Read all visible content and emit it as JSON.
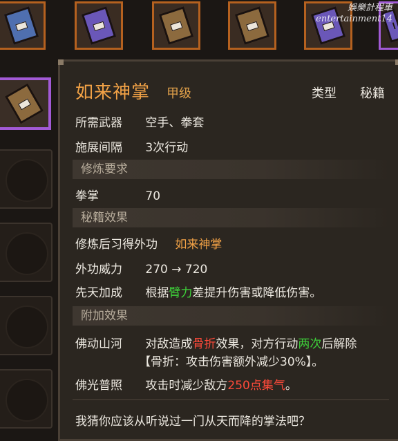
{
  "watermark": {
    "line1": "娛樂計程車",
    "line2": "entertainment14"
  },
  "inventory_top": [
    {
      "icon": "blue-book-icon",
      "color": "#4f6fb0"
    },
    {
      "icon": "purple-book-icon",
      "color": "#6a57b8"
    },
    {
      "icon": "brown-book-icon",
      "color": "#8c6a3e"
    },
    {
      "icon": "brown-book-icon",
      "color": "#8c6a3e"
    },
    {
      "icon": "purple-book-icon",
      "color": "#6a57b8"
    },
    {
      "icon": "book-icon",
      "color": "#6a57b8"
    }
  ],
  "tooltip": {
    "title": "如来神掌",
    "grade": "甲级",
    "type_label": "类型",
    "type_value": "秘籍",
    "weapon_label": "所需武器",
    "weapon_value": "空手、拳套",
    "interval_label": "施展间隔",
    "interval_value": "3次行动",
    "req_header": "修炼要求",
    "req_label": "拳掌",
    "req_value": "70",
    "effect_header": "秘籍效果",
    "learn_label": "修炼后习得外功",
    "learn_value": "如来神掌",
    "power_label": "外功威力",
    "power_value": "270 → 720",
    "innate_label": "先天加成",
    "innate_pre": "根据",
    "innate_hl": "臂力",
    "innate_post": "差提升伤害或降低伤害。",
    "extra_header": "附加效果",
    "e1_label": "佛动山河",
    "e1_pre": "对敌造成",
    "e1_hl1": "骨折",
    "e1_mid": "效果，对方行动",
    "e1_hl2": "两次",
    "e1_post": "后解除",
    "e1_line2": "【骨折：攻击伤害额外减少30%】。",
    "e2_label": "佛光普照",
    "e2_pre": "攻击时减少敌方",
    "e2_hl": "250点集气",
    "e2_post": "。",
    "flavor": "我猜你应该从听说过一门从天而降的掌法吧？"
  },
  "colors": {
    "accent_orange": "#f2a246",
    "highlight_green": "#3ed13a",
    "highlight_red": "#ff4a3a",
    "selected_border": "#a25ad6"
  }
}
